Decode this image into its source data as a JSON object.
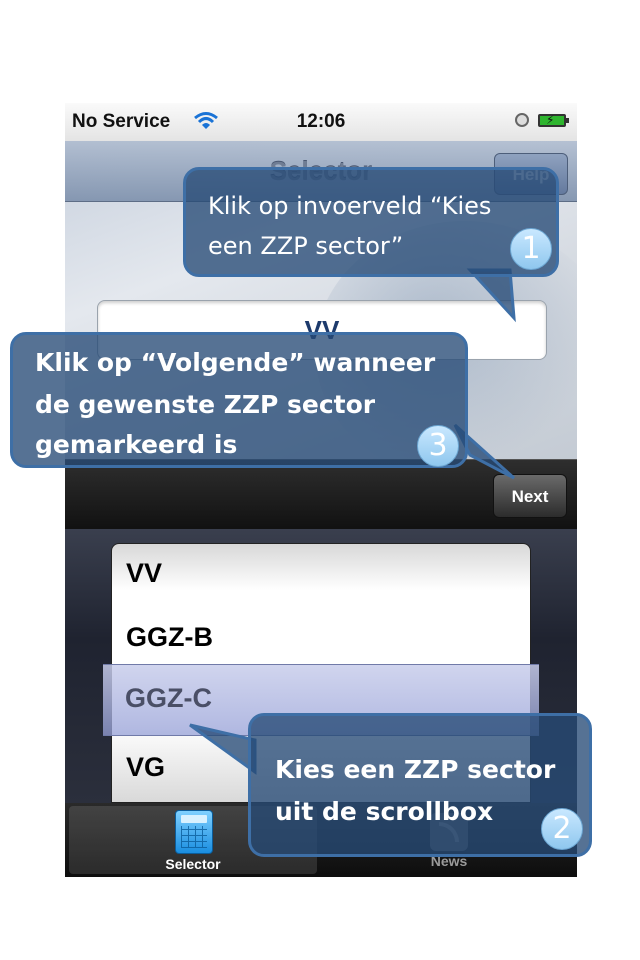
{
  "status_bar": {
    "carrier": "No Service",
    "time": "12:06"
  },
  "nav_bar": {
    "title": "Selector",
    "help_label": "Help"
  },
  "sector_field": {
    "value": "VV"
  },
  "toolbar": {
    "next_label": "Next"
  },
  "picker": {
    "rows": [
      "VV",
      "GGZ-B",
      "GGZ-C",
      "VG"
    ],
    "selected": "GGZ-C"
  },
  "tab_bar": {
    "tabs": [
      {
        "label": "Selector",
        "icon": "calculator-icon",
        "active": true
      },
      {
        "label": "News",
        "icon": "rss-icon",
        "active": false
      }
    ]
  },
  "callouts": [
    {
      "number": "1",
      "text_lines": [
        "Klik op invoerveld “Kies",
        "een ZZP sector”"
      ]
    },
    {
      "number": "2",
      "text_lines": [
        "Kies een ZZP sector",
        "uit de scrollbox"
      ]
    },
    {
      "number": "3",
      "text_lines": [
        "Klik op “Volgende” wanneer",
        "de gewenste ZZP sector",
        "gemarkeerd is"
      ]
    }
  ],
  "colors": {
    "callout_fill": "#264a76",
    "callout_border": "#3e6fa6",
    "badge": "#a9d6f5"
  }
}
